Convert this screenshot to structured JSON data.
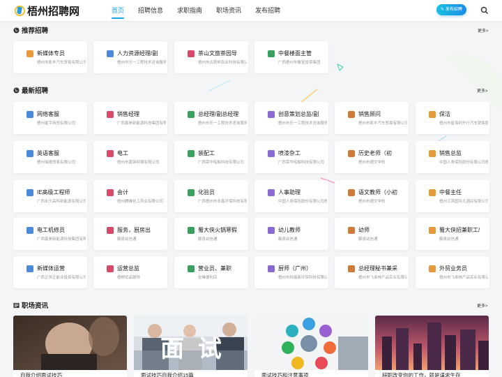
{
  "header": {
    "logo_text": "梧州招聘网",
    "nav": [
      "首页",
      "招聘信息",
      "求职指南",
      "职场资讯",
      "发布招聘"
    ],
    "publish_button": "发布招聘",
    "icons": {
      "search": "search-icon",
      "publish": "pencil-icon"
    }
  },
  "recommended": {
    "title": "推荐招聘",
    "more": "更多>",
    "jobs": [
      {
        "title": "新媒体专员",
        "company": "梧州市凯丰汽车贸易有限公司"
      },
      {
        "title": "人力资源经理/副",
        "company": "梧州市乐一工程技术咨询服务有"
      },
      {
        "title": "茶山文旅茶园导",
        "company": "梧州市古琵邦农业科技有限公司"
      },
      {
        "title": "中餐楼面主管",
        "company": "广西梧州市聚宝投资集团"
      }
    ]
  },
  "latest": {
    "title": "最新招聘",
    "more": "更多>",
    "rows": [
      [
        {
          "title": "网络客服",
          "company": "梧州星宇商贸有限公司"
        },
        {
          "title": "销售经理",
          "company": "广西鑫昊新能源科技集团有限"
        },
        {
          "title": "总经理/副总经理",
          "company": "梧州市乐一工程技术咨询服务有"
        },
        {
          "title": "创意策划总监/副",
          "company": "梧州市乐一工程技术咨询服务有"
        },
        {
          "title": "销售顾问",
          "company": "梧州市凯丰汽车贸易有限公司"
        },
        {
          "title": "保洁",
          "company": "梧州市星海利升行汽车销售服"
        }
      ],
      [
        {
          "title": "英语客服",
          "company": "梧州瑞德贸易有限公司"
        },
        {
          "title": "电工",
          "company": "梧州市鑫锋特钢有限公司"
        },
        {
          "title": "装配工",
          "company": "广西荣华船舶科技有限公司"
        },
        {
          "title": "喷漆杂工",
          "company": "广西荣华船舶科技有限公司"
        },
        {
          "title": "历史老师（初",
          "company": "梧州市德文学校"
        },
        {
          "title": "销售总监",
          "company": "中国人寿保险股份有限公司梧州"
        }
      ],
      [
        {
          "title": "IE高级工程师",
          "company": "广西永乐高科新能源有限公司"
        },
        {
          "title": "会计",
          "company": "梧州腾峰化工药业有限公司"
        },
        {
          "title": "化验员",
          "company": "广西梧州市永鑫环保科技有限"
        },
        {
          "title": "人事助理",
          "company": "中国人寿保险股份有限公司梧"
        },
        {
          "title": "语文教师（小初",
          "company": "梧州市德文学校"
        },
        {
          "title": "中餐主任",
          "company": "梧州江滨国际大酒店有限公司"
        }
      ],
      [
        {
          "title": "电工机修员",
          "company": "广西鑫昊新能源科技集团有限"
        },
        {
          "title": "服务，厨房出",
          "company": "藤县幼信通"
        },
        {
          "title": "蜀大侠火锅寒假",
          "company": "藤县幼信通"
        },
        {
          "title": "幼儿教师",
          "company": "藤县幼信通"
        },
        {
          "title": "幼师",
          "company": "藤县幼信通"
        },
        {
          "title": "蜀大侠招兼职工/",
          "company": "藤县幼信通"
        }
      ],
      [
        {
          "title": "新媒体运营",
          "company": "广西正恒正能业投资有限公司"
        },
        {
          "title": "运营总监",
          "company": "梧桐优品服饰"
        },
        {
          "title": "营业员、兼职",
          "company": "全峰便利店"
        },
        {
          "title": "厨师（广州）",
          "company": "梧州市科能新环保科技有限公"
        },
        {
          "title": "总经理秘书兼采",
          "company": "梧州市飞卓林产品实业有限公"
        },
        {
          "title": "外贸业务员",
          "company": "梧州市飞卓林产品实业有限公"
        }
      ]
    ]
  },
  "news": {
    "title": "职场资讯",
    "more": "更多>",
    "articles": [
      {
        "caption": "自我介绍面试技巧"
      },
      {
        "caption": "面试技巧自我介绍15篇",
        "overlay": "面 试"
      },
      {
        "caption": "面试技巧和注意事项"
      },
      {
        "caption": "辞职改变你的工作，就是谋求生存"
      }
    ]
  },
  "colors": {
    "accent": "#1aa3e8",
    "background": "#f4f5f7",
    "card": "#ffffff",
    "company_text": "#999999"
  }
}
